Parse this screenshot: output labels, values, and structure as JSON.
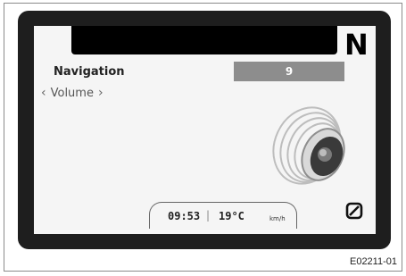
{
  "header": {
    "gear_indicator": "N"
  },
  "menu": {
    "title": "Navigation",
    "value": "9",
    "submenu_prev": "‹",
    "submenu_label": "Volume",
    "submenu_next": "›"
  },
  "status": {
    "time": "09:53",
    "separator": "|",
    "temperature": "19°C",
    "speed_unit": "km/h"
  },
  "icons": {
    "main_graphic": "speaker-icon",
    "corner": "power-off-icon"
  },
  "caption": "E02211-01"
}
